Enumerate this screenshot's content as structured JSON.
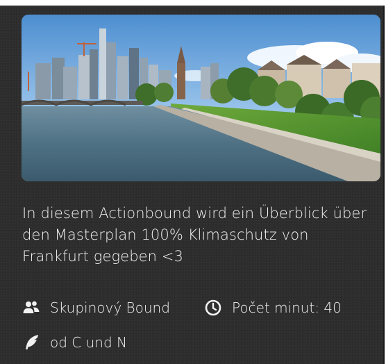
{
  "bound": {
    "description": "In diesem Actionbound wird ein Überblick über den Masterplan 100% Klimaschutz von Frankfurt gegeben <3",
    "type_label": "Skupinový Bound",
    "duration_label": "Počet minut: 40",
    "author_label": "od C und N"
  },
  "icons": {
    "group": "group-users-icon",
    "duration": "clock-icon",
    "author": "feather-quill-icon"
  },
  "colors": {
    "card_background": "#2d2d2d",
    "text": "#f2f2f2"
  }
}
